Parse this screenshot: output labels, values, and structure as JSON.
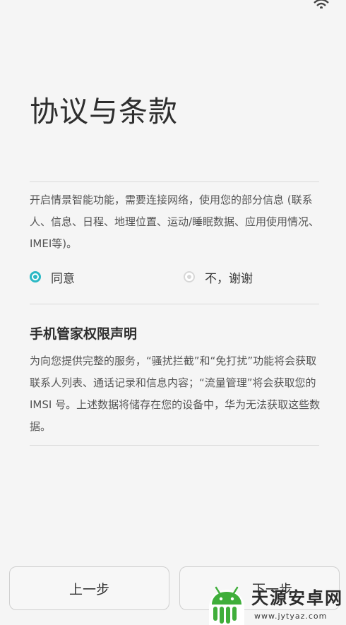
{
  "header": {
    "title": "协议与条款"
  },
  "smart_scene": {
    "description": "开启情景智能功能，需要连接网络，使用您的部分信息 (联系人、信息、日程、地理位置、运动/睡眠数据、应用使用情况、IMEI等)。",
    "options": [
      {
        "label": "同意",
        "selected": true
      },
      {
        "label": "不，谢谢",
        "selected": false
      }
    ]
  },
  "permission_notice": {
    "title": "手机管家权限声明",
    "body": "为向您提供完整的服务，“骚扰拦截”和“免打扰”功能将会获取联系人列表、通话记录和信息内容；“流量管理”将会获取您的 IMSI 号。上述数据将储存在您的设备中，华为无法获取这些数据。"
  },
  "footer": {
    "prev_label": "上一步",
    "next_label": "下一步"
  },
  "watermark": {
    "brand": "天源安卓网",
    "url": "www.jytyaz.com"
  },
  "colors": {
    "accent": "#2bb8c4",
    "background": "#f5f5f5",
    "watermark_green": "#3fae3a"
  },
  "icons": {
    "status": "wifi-icon",
    "watermark_logo": "android-logo-icon"
  }
}
